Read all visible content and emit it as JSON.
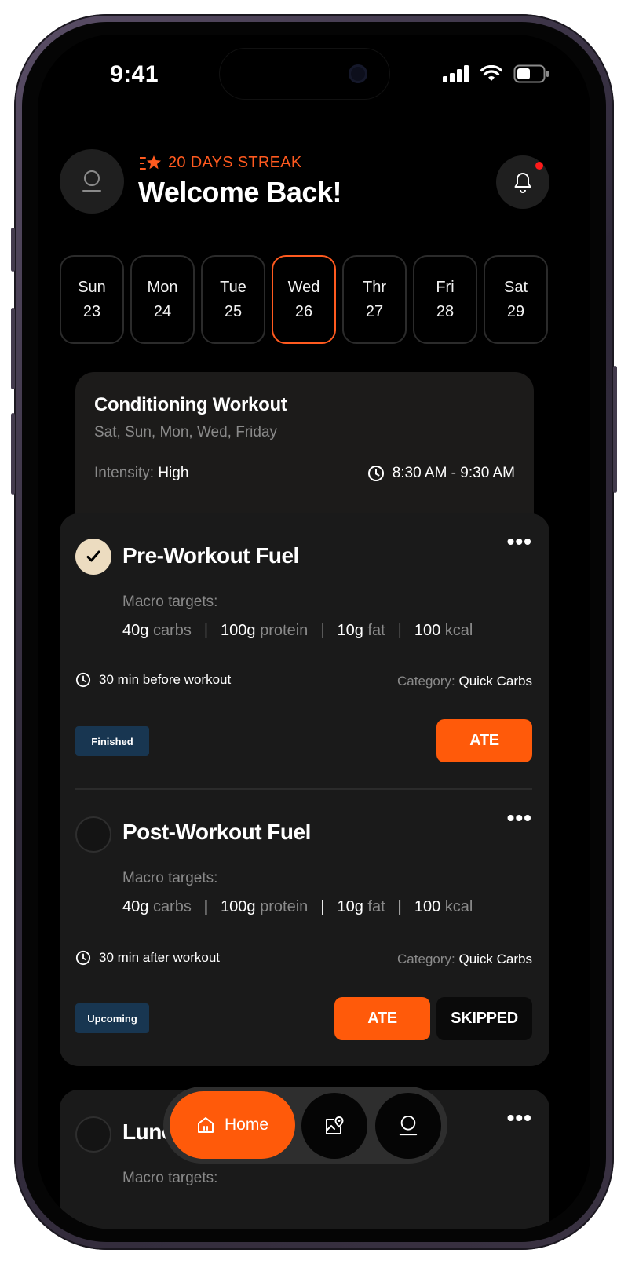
{
  "status_bar": {
    "time": "9:41"
  },
  "header": {
    "streak_text": "20 DAYS STREAK",
    "greeting": "Welcome Back!"
  },
  "days": [
    {
      "name": "Sun",
      "date": "23"
    },
    {
      "name": "Mon",
      "date": "24"
    },
    {
      "name": "Tue",
      "date": "25"
    },
    {
      "name": "Wed",
      "date": "26",
      "selected": true
    },
    {
      "name": "Thr",
      "date": "27"
    },
    {
      "name": "Fri",
      "date": "28"
    },
    {
      "name": "Sat",
      "date": "29"
    }
  ],
  "workout": {
    "title": "Conditioning Workout",
    "days": "Sat, Sun, Mon, Wed, Friday",
    "intensity_label": "Intensity:",
    "intensity_value": "High",
    "time": "8:30 AM - 9:30 AM"
  },
  "meals": [
    {
      "title": "Pre-Workout Fuel",
      "completed": true,
      "macro_label": "Macro targets:",
      "carbs_value": "40g",
      "carbs_unit": "carbs",
      "protein_value": "100g",
      "protein_unit": "protein",
      "fat_value": "10g",
      "fat_unit": "fat",
      "kcal_value": "100",
      "kcal_unit": "kcal",
      "timing": "30 min before workout",
      "category_label": "Category:",
      "category_value": "Quick Carbs",
      "status": "Finished",
      "ate_label": "ATE"
    },
    {
      "title": "Post-Workout Fuel",
      "completed": false,
      "macro_label": "Macro targets:",
      "carbs_value": "40g",
      "carbs_unit": "carbs",
      "protein_value": "100g",
      "protein_unit": "protein",
      "fat_value": "10g",
      "fat_unit": "fat",
      "kcal_value": "100",
      "kcal_unit": "kcal",
      "timing": "30 min after workout",
      "category_label": "Category:",
      "category_value": "Quick Carbs",
      "status": "Upcoming",
      "ate_label": "ATE",
      "skip_label": "SKIPPED"
    },
    {
      "title": "Lunch",
      "macro_label": "Macro targets:"
    }
  ],
  "more_symbol": "•••",
  "tabbar": {
    "home_label": "Home"
  },
  "colors": {
    "accent": "#ff5a0a",
    "badge": "#183651",
    "check_done": "#ecdcc0"
  }
}
